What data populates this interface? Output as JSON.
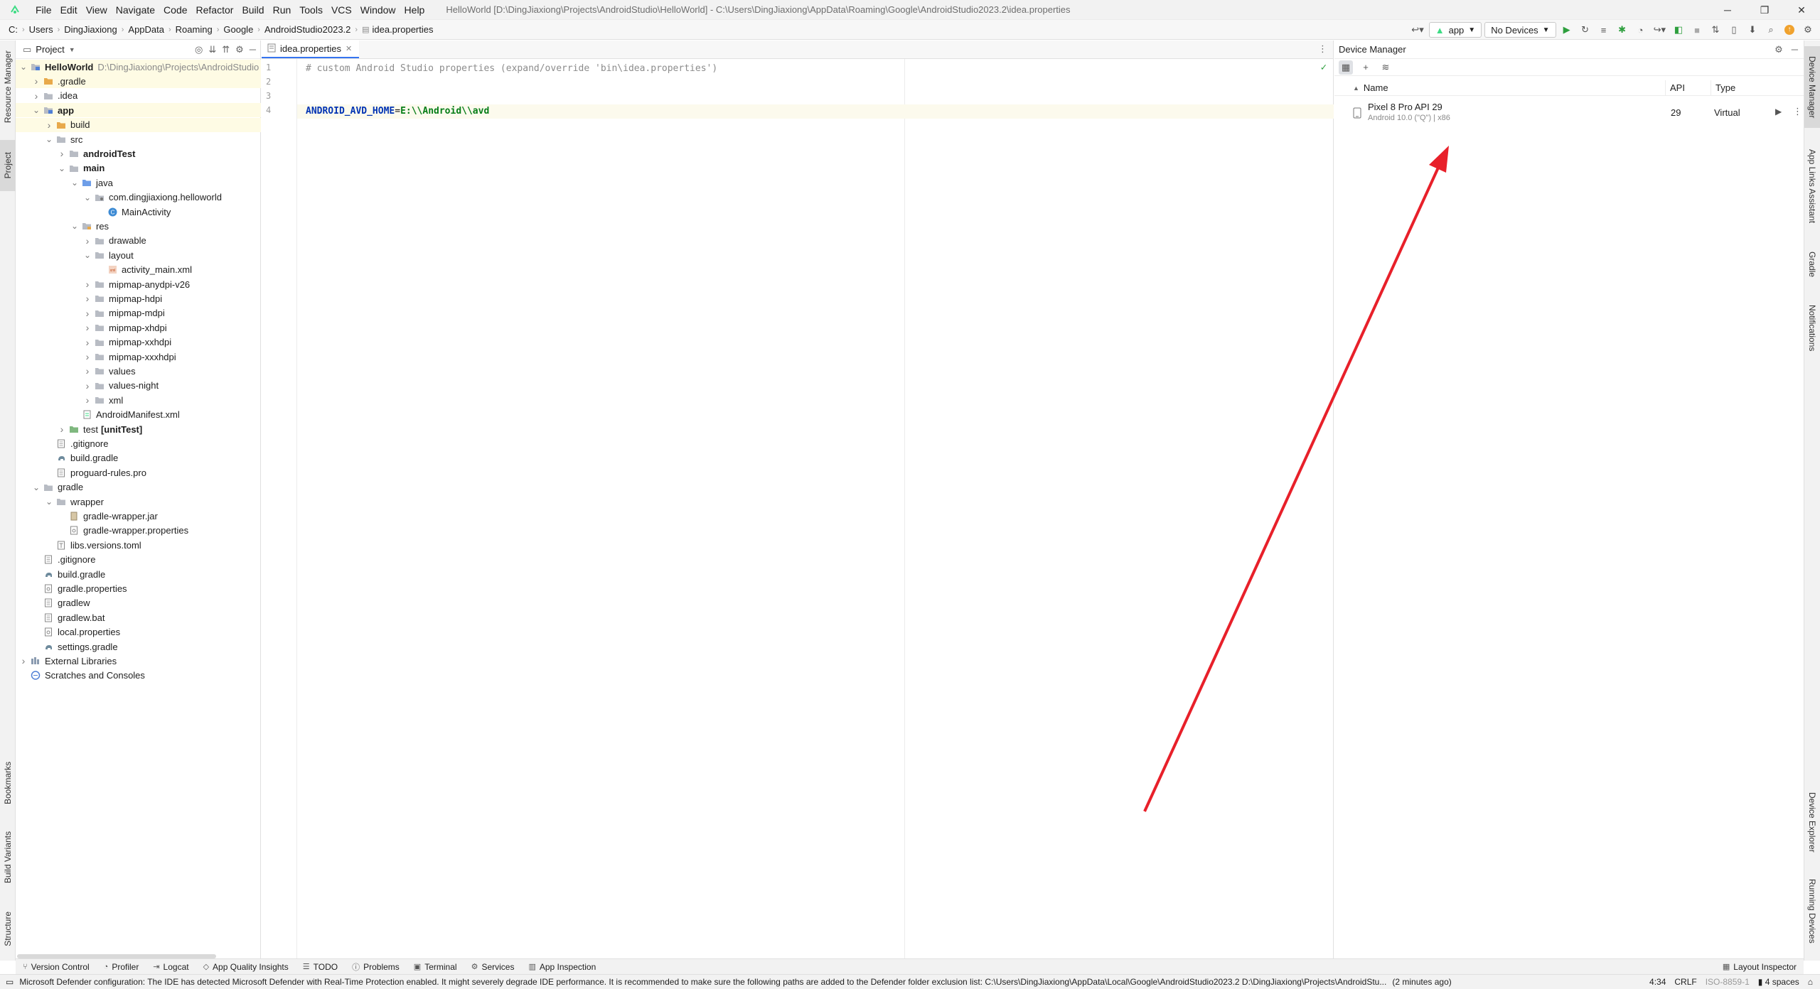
{
  "menu": [
    "File",
    "Edit",
    "View",
    "Navigate",
    "Code",
    "Refactor",
    "Build",
    "Run",
    "Tools",
    "VCS",
    "Window",
    "Help"
  ],
  "window_title": "HelloWorld [D:\\DingJiaxiong\\Projects\\AndroidStudio\\HelloWorld] - C:\\Users\\DingJiaxiong\\AppData\\Roaming\\Google\\AndroidStudio2023.2\\idea.properties",
  "breadcrumbs": [
    "C:",
    "Users",
    "DingJiaxiong",
    "AppData",
    "Roaming",
    "Google",
    "AndroidStudio2023.2",
    "idea.properties"
  ],
  "toolbar": {
    "run_config": "app",
    "device_selector": "No Devices"
  },
  "left_stripe": {
    "top": [
      "Resource Manager",
      "Project"
    ],
    "bottom": [
      "Bookmarks",
      "Build Variants",
      "Structure"
    ]
  },
  "right_stripe": {
    "top": [
      "Device Manager",
      "App Links Assistant",
      "Gradle",
      "Notifications"
    ],
    "bottom": [
      "Device Explorer",
      "Running Devices"
    ]
  },
  "project": {
    "title": "Project",
    "tree": [
      {
        "label": "HelloWorld",
        "suffix": "D:\\DingJiaxiong\\Projects\\AndroidStudio",
        "depth": 0,
        "chev": "down",
        "icon": "module",
        "bold": true,
        "hl": true
      },
      {
        "label": ".gradle",
        "depth": 1,
        "chev": "right",
        "icon": "folder-orange",
        "hl": true
      },
      {
        "label": ".idea",
        "depth": 1,
        "chev": "right",
        "icon": "folder"
      },
      {
        "label": "app",
        "depth": 1,
        "chev": "down",
        "icon": "module",
        "bold": true,
        "hl": true
      },
      {
        "label": "build",
        "depth": 2,
        "chev": "right",
        "icon": "folder-orange",
        "hl": true
      },
      {
        "label": "src",
        "depth": 2,
        "chev": "down",
        "icon": "folder"
      },
      {
        "label": "androidTest",
        "depth": 3,
        "chev": "right",
        "icon": "folder",
        "bold": true
      },
      {
        "label": "main",
        "depth": 3,
        "chev": "down",
        "icon": "folder",
        "bold": true
      },
      {
        "label": "java",
        "depth": 4,
        "chev": "down",
        "icon": "folder-blue"
      },
      {
        "label": "com.dingjiaxiong.helloworld",
        "depth": 5,
        "chev": "down",
        "icon": "package"
      },
      {
        "label": "MainActivity",
        "depth": 6,
        "chev": "",
        "icon": "class"
      },
      {
        "label": "res",
        "depth": 4,
        "chev": "down",
        "icon": "folder-res"
      },
      {
        "label": "drawable",
        "depth": 5,
        "chev": "right",
        "icon": "folder"
      },
      {
        "label": "layout",
        "depth": 5,
        "chev": "down",
        "icon": "folder"
      },
      {
        "label": "activity_main.xml",
        "depth": 6,
        "chev": "",
        "icon": "xml"
      },
      {
        "label": "mipmap-anydpi-v26",
        "depth": 5,
        "chev": "right",
        "icon": "folder"
      },
      {
        "label": "mipmap-hdpi",
        "depth": 5,
        "chev": "right",
        "icon": "folder"
      },
      {
        "label": "mipmap-mdpi",
        "depth": 5,
        "chev": "right",
        "icon": "folder"
      },
      {
        "label": "mipmap-xhdpi",
        "depth": 5,
        "chev": "right",
        "icon": "folder"
      },
      {
        "label": "mipmap-xxhdpi",
        "depth": 5,
        "chev": "right",
        "icon": "folder"
      },
      {
        "label": "mipmap-xxxhdpi",
        "depth": 5,
        "chev": "right",
        "icon": "folder"
      },
      {
        "label": "values",
        "depth": 5,
        "chev": "right",
        "icon": "folder"
      },
      {
        "label": "values-night",
        "depth": 5,
        "chev": "right",
        "icon": "folder"
      },
      {
        "label": "xml",
        "depth": 5,
        "chev": "right",
        "icon": "folder"
      },
      {
        "label": "AndroidManifest.xml",
        "depth": 4,
        "chev": "",
        "icon": "manifest"
      },
      {
        "label": "test",
        "suffix_bold": "[unitTest]",
        "depth": 3,
        "chev": "right",
        "icon": "folder-test"
      },
      {
        "label": ".gitignore",
        "depth": 2,
        "chev": "",
        "icon": "file"
      },
      {
        "label": "build.gradle",
        "depth": 2,
        "chev": "",
        "icon": "gradle"
      },
      {
        "label": "proguard-rules.pro",
        "depth": 2,
        "chev": "",
        "icon": "file"
      },
      {
        "label": "gradle",
        "depth": 1,
        "chev": "down",
        "icon": "folder"
      },
      {
        "label": "wrapper",
        "depth": 2,
        "chev": "down",
        "icon": "folder"
      },
      {
        "label": "gradle-wrapper.jar",
        "depth": 3,
        "chev": "",
        "icon": "jar"
      },
      {
        "label": "gradle-wrapper.properties",
        "depth": 3,
        "chev": "",
        "icon": "props"
      },
      {
        "label": "libs.versions.toml",
        "depth": 2,
        "chev": "",
        "icon": "toml"
      },
      {
        "label": ".gitignore",
        "depth": 1,
        "chev": "",
        "icon": "file"
      },
      {
        "label": "build.gradle",
        "depth": 1,
        "chev": "",
        "icon": "gradle"
      },
      {
        "label": "gradle.properties",
        "depth": 1,
        "chev": "",
        "icon": "props"
      },
      {
        "label": "gradlew",
        "depth": 1,
        "chev": "",
        "icon": "file"
      },
      {
        "label": "gradlew.bat",
        "depth": 1,
        "chev": "",
        "icon": "file"
      },
      {
        "label": "local.properties",
        "depth": 1,
        "chev": "",
        "icon": "props"
      },
      {
        "label": "settings.gradle",
        "depth": 1,
        "chev": "",
        "icon": "gradle"
      },
      {
        "label": "External Libraries",
        "depth": 0,
        "chev": "right",
        "icon": "libs"
      },
      {
        "label": "Scratches and Consoles",
        "depth": 0,
        "chev": "",
        "icon": "scratch"
      }
    ]
  },
  "editor": {
    "tab": "idea.properties",
    "line_numbers": [
      "1",
      "2",
      "3",
      "4"
    ],
    "line1": "# custom Android Studio properties (expand/override 'bin\\idea.properties')",
    "line4_key": "ANDROID_AVD_HOME",
    "line4_eq": "=",
    "line4_val": "E:\\\\Android\\\\avd"
  },
  "device_manager": {
    "title": "Device Manager",
    "columns": {
      "name": "Name",
      "api": "API",
      "type": "Type"
    },
    "device": {
      "name": "Pixel 8 Pro API 29",
      "sub": "Android 10.0 (\"Q\") | x86",
      "api": "29",
      "type": "Virtual"
    }
  },
  "bottom_tools": [
    "Version Control",
    "Profiler",
    "Logcat",
    "App Quality Insights",
    "TODO",
    "Problems",
    "Terminal",
    "Services",
    "App Inspection"
  ],
  "bottom_right_tool": "Layout Inspector",
  "status": {
    "message": "Microsoft Defender configuration: The IDE has detected Microsoft Defender with Real-Time Protection enabled. It might severely degrade IDE performance. It is recommended to make sure the following paths are added to the Defender folder exclusion list: C:\\Users\\DingJiaxiong\\AppData\\Local\\Google\\AndroidStudio2023.2 D:\\DingJiaxiong\\Projects\\AndroidStu...",
    "time_ago": "(2 minutes ago)",
    "position": "4:34",
    "line_sep": "CRLF",
    "encoding": "ISO-8859-1",
    "indent": "4 spaces"
  },
  "colors": {
    "accent": "#3574f0",
    "annotation": "#e8202a",
    "key": "#0033b3",
    "value": "#067d17"
  }
}
